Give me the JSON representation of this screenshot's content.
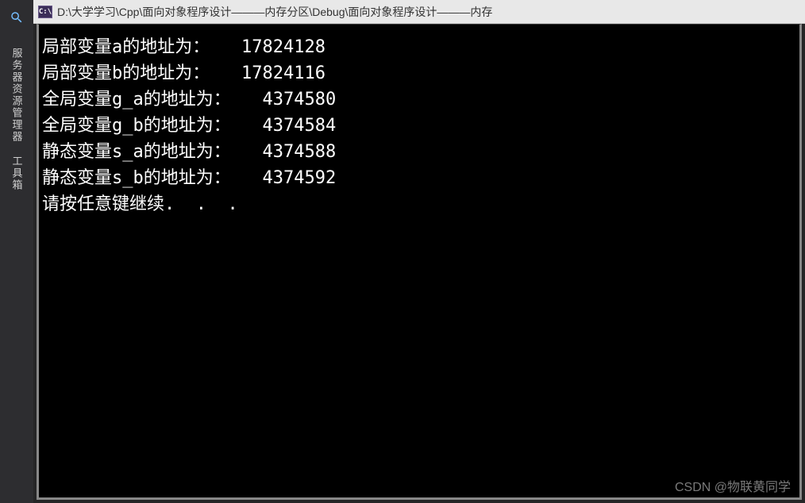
{
  "sidebar": {
    "items": [
      {
        "label": "服务器资源管理器"
      },
      {
        "label": "工具箱"
      }
    ]
  },
  "titlebar": {
    "icon_label": "C:\\",
    "path": "D:\\大学学习\\Cpp\\面向对象程序设计———内存分区\\Debug\\面向对象程序设计———内存"
  },
  "console": {
    "lines": [
      "局部变量a的地址为：   17824128",
      "局部变量b的地址为：   17824116",
      "全局变量g_a的地址为：   4374580",
      "全局变量g_b的地址为：   4374584",
      "静态变量s_a的地址为：   4374588",
      "静态变量s_b的地址为：   4374592",
      "请按任意键继续.  .  ."
    ]
  },
  "watermark": "CSDN @物联黄同学"
}
